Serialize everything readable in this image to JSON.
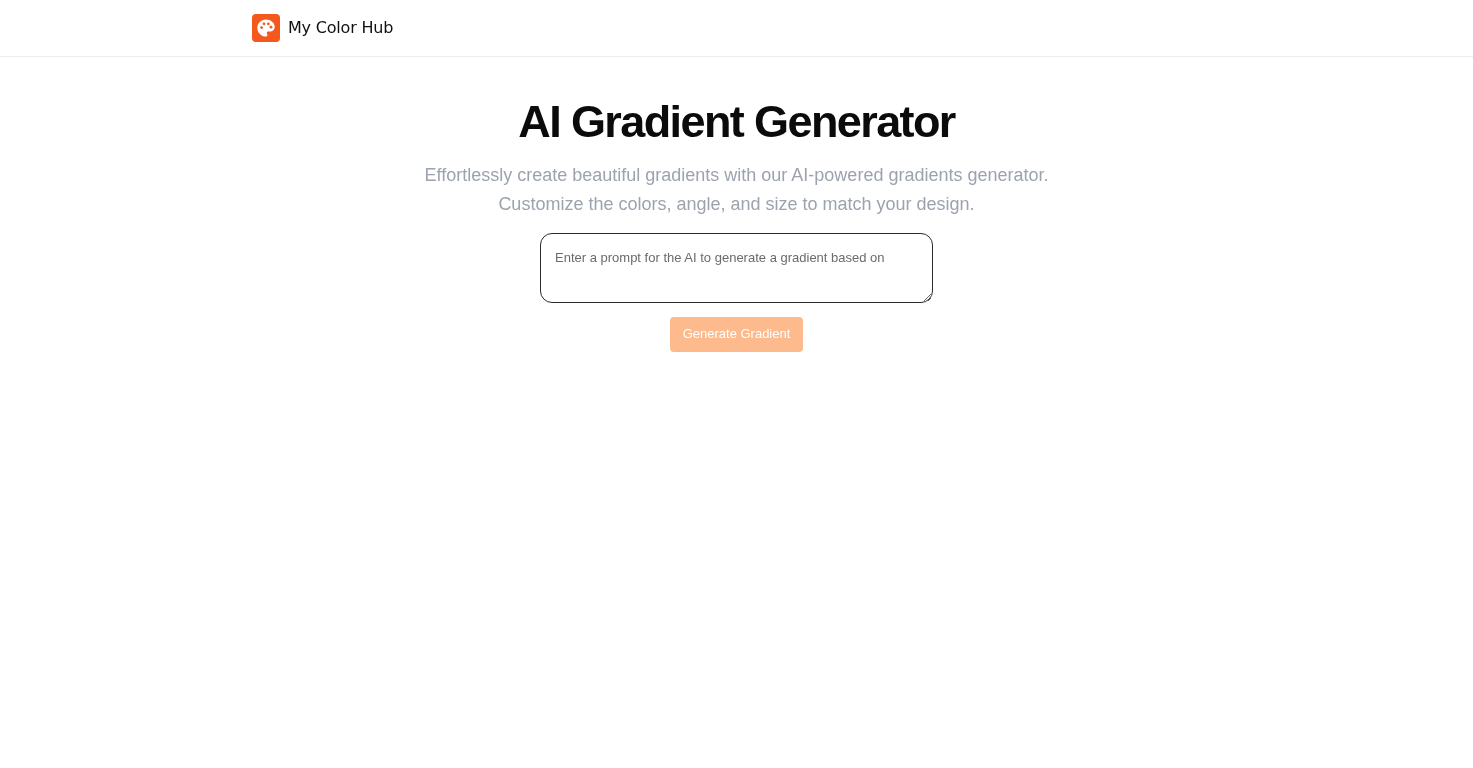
{
  "header": {
    "brand": "My Color Hub"
  },
  "hero": {
    "title": "AI Gradient Generator",
    "subtitle": "Effortlessly create beautiful gradients with our AI-powered gradients generator. Customize the colors, angle, and size to match your design."
  },
  "prompt": {
    "placeholder": "Enter a prompt for the AI to generate a gradient based on"
  },
  "generate_button": {
    "label": "Generate Gradient",
    "disabled": true
  }
}
